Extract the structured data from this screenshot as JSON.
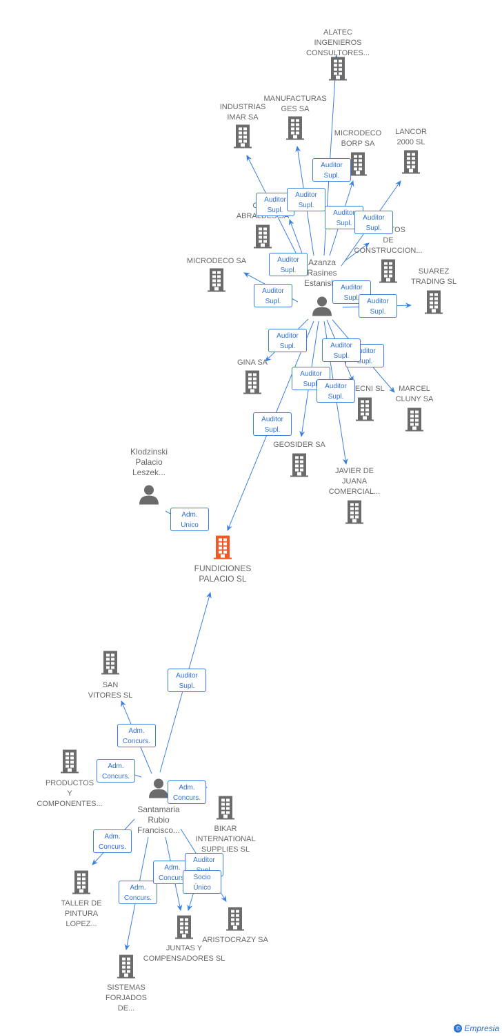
{
  "colors": {
    "edge": "#3b7fe0",
    "node": "#6b6b6b",
    "highlight": "#f05a28"
  },
  "nodes": [
    {
      "id": "alatec",
      "type": "company",
      "label": "ALATEC\nINGENIEROS\nCONSULTORES..."
    },
    {
      "id": "industrias",
      "type": "company",
      "label": "INDUSTRIAS\nIMAR SA"
    },
    {
      "id": "manufacturas",
      "type": "company",
      "label": "MANUFACTURAS\nGES SA"
    },
    {
      "id": "borp",
      "type": "company",
      "label": "MICRODECO\nBORP SA"
    },
    {
      "id": "lancor",
      "type": "company",
      "label": "LANCOR\n2000 SL"
    },
    {
      "id": "chat",
      "type": "company",
      "label": "CHAT\nABRALDES SA"
    },
    {
      "id": "mientos",
      "type": "company",
      "label": "MIENTOS\nDE\nCONSTRUCCION..."
    },
    {
      "id": "microdeco",
      "type": "company",
      "label": "MICRODECO SA"
    },
    {
      "id": "suarez",
      "type": "company",
      "label": "SUAREZ\nTRADING SL"
    },
    {
      "id": "azanza",
      "type": "person",
      "label": "Azanza\nRasines\nEstanisl..."
    },
    {
      "id": "gina",
      "type": "company",
      "label": "GINA SA"
    },
    {
      "id": "rtecni",
      "type": "company",
      "label": "RTECNI SL"
    },
    {
      "id": "marcel",
      "type": "company",
      "label": "MARCEL\nCLUNY SA"
    },
    {
      "id": "geosider",
      "type": "company",
      "label": "GEOSIDER SA"
    },
    {
      "id": "javier",
      "type": "company",
      "label": "JAVIER DE\nJUANA\nCOMERCIAL..."
    },
    {
      "id": "klodzinski",
      "type": "person",
      "label": "Klodzinski\nPalacio\nLeszek..."
    },
    {
      "id": "fundiciones",
      "type": "company",
      "highlight": true,
      "label": "FUNDICIONES\nPALACIO SL"
    },
    {
      "id": "sanvitores",
      "type": "company",
      "label": "SAN\nVITORES SL"
    },
    {
      "id": "productos",
      "type": "company",
      "label": "PRODUCTOS\nY\nCOMPONENTES..."
    },
    {
      "id": "santamaria",
      "type": "person",
      "label": "Santamaria\nRubio\nFrancisco..."
    },
    {
      "id": "bikar",
      "type": "company",
      "label": "BIKAR\nINTERNATIONAL\nSUPPLIES SL"
    },
    {
      "id": "taller",
      "type": "company",
      "label": "TALLER DE\nPINTURA\nLOPEZ..."
    },
    {
      "id": "juntas",
      "type": "company",
      "label": "JUNTAS Y\nCOMPENSADORES SL"
    },
    {
      "id": "aristocrazy",
      "type": "company",
      "label": "ARISTOCRAZY SA"
    },
    {
      "id": "sistemas",
      "type": "company",
      "label": "SISTEMAS\nFORJADOS\nDE..."
    }
  ],
  "edges": [
    {
      "from": "azanza",
      "to": "alatec",
      "role": "Auditor\nSupl."
    },
    {
      "from": "azanza",
      "to": "industrias",
      "role": "Auditor\nSupl."
    },
    {
      "from": "azanza",
      "to": "manufacturas",
      "role": "Auditor\nSupl."
    },
    {
      "from": "azanza",
      "to": "borp",
      "role": "Auditor\nSupl."
    },
    {
      "from": "azanza",
      "to": "lancor",
      "role": "Auditor\nSupl."
    },
    {
      "from": "azanza",
      "to": "chat",
      "role": "Auditor\nSupl."
    },
    {
      "from": "azanza",
      "to": "microdeco",
      "role": "Auditor\nSupl."
    },
    {
      "from": "azanza",
      "to": "mientos",
      "role": "Auditor\nSupl."
    },
    {
      "from": "azanza",
      "to": "suarez",
      "role": "Auditor\nSupl."
    },
    {
      "from": "azanza",
      "to": "gina",
      "role": "Auditor\nSupl."
    },
    {
      "from": "azanza",
      "to": "marcel",
      "role": "Auditor\nSupl."
    },
    {
      "from": "azanza",
      "to": "rtecni",
      "role": "Auditor\nSupl."
    },
    {
      "from": "azanza",
      "to": "geosider",
      "role": "Auditor\nSupl."
    },
    {
      "from": "azanza",
      "to": "javier",
      "role": "Auditor\nSupl."
    },
    {
      "from": "azanza",
      "to": "fundiciones",
      "role": "Auditor\nSupl."
    },
    {
      "from": "klodzinski",
      "to": "fundiciones",
      "role": "Adm.\nUnico"
    },
    {
      "from": "santamaria",
      "to": "fundiciones",
      "role": "Auditor\nSupl."
    },
    {
      "from": "santamaria",
      "to": "sanvitores",
      "role": "Adm.\nConcurs."
    },
    {
      "from": "santamaria",
      "to": "productos",
      "role": "Adm.\nConcurs."
    },
    {
      "from": "santamaria",
      "to": "bikar",
      "role": "Adm.\nConcurs."
    },
    {
      "from": "santamaria",
      "to": "taller",
      "role": "Adm.\nConcurs."
    },
    {
      "from": "santamaria",
      "to": "juntas",
      "role": "Adm.\nConcurs."
    },
    {
      "from": "santamaria",
      "to": "sistemas",
      "role": "Adm.\nConcurs."
    },
    {
      "from": "santamaria",
      "to": "aristocrazy",
      "role": "Auditor\nSupl."
    },
    {
      "from": "santamaria",
      "to": "juntas",
      "role": "Socio\nÚnico"
    }
  ],
  "footer": {
    "brand": "Empresia",
    "copyright_symbol": "©"
  }
}
